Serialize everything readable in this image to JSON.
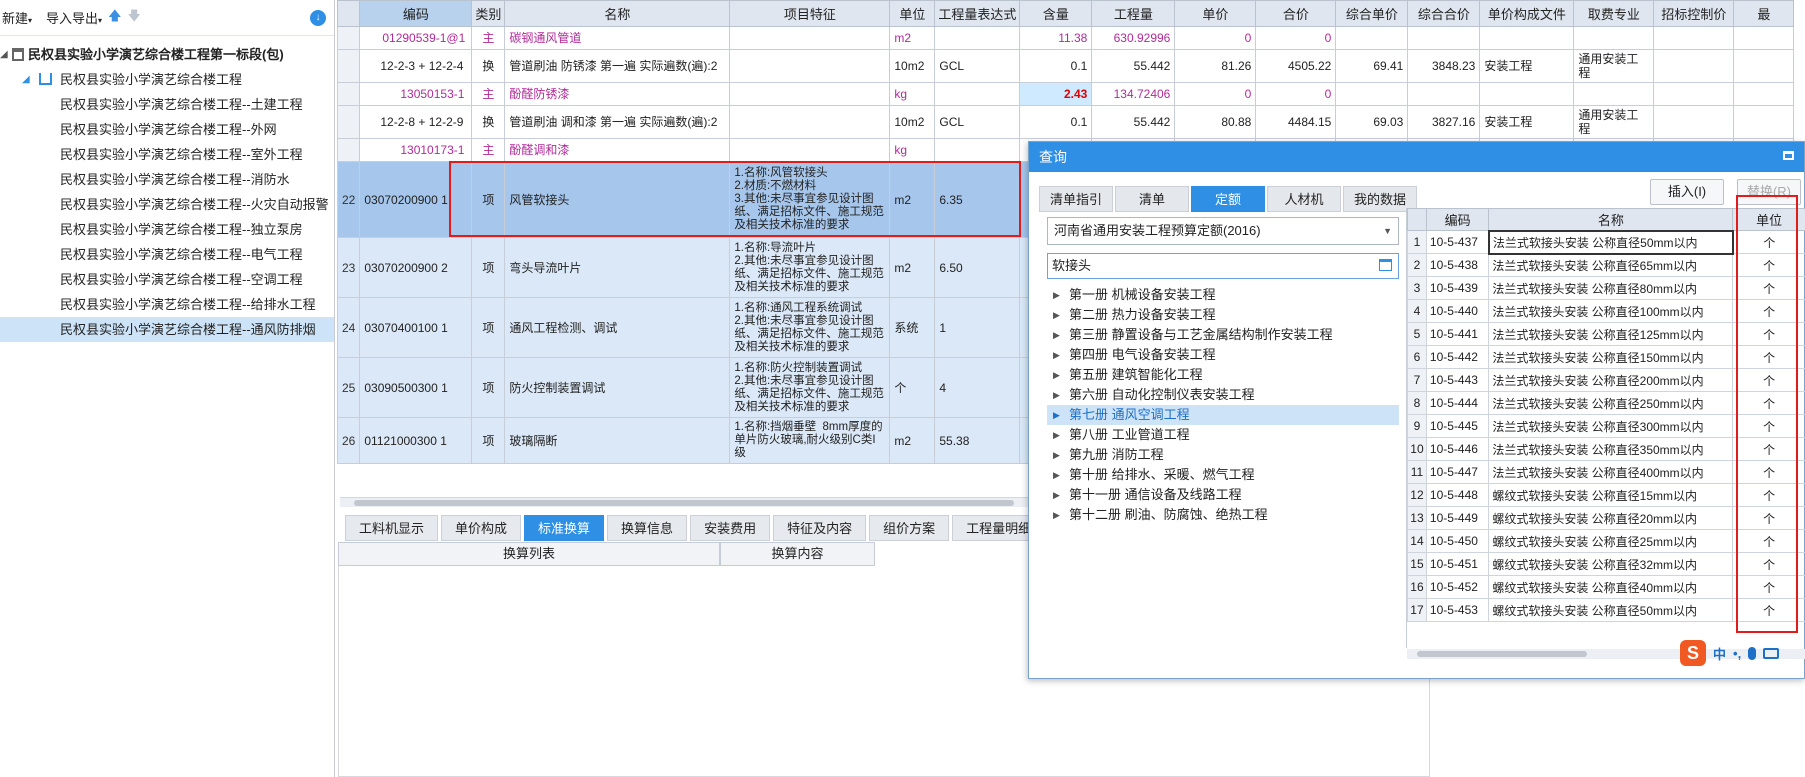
{
  "toolbar": {
    "new_label": "新建",
    "import_export_label": "导入导出"
  },
  "tree": {
    "root": "民权县实验小学演艺综合楼工程第一标段(包)",
    "project": "民权县实验小学演艺综合楼工程",
    "items": [
      "民权县实验小学演艺综合楼工程--土建工程",
      "民权县实验小学演艺综合楼工程--外网",
      "民权县实验小学演艺综合楼工程--室外工程",
      "民权县实验小学演艺综合楼工程--消防水",
      "民权县实验小学演艺综合楼工程--火灾自动报警",
      "民权县实验小学演艺综合楼工程--独立泵房",
      "民权县实验小学演艺综合楼工程--电气工程",
      "民权县实验小学演艺综合楼工程--空调工程",
      "民权县实验小学演艺综合楼工程--给排水工程",
      "民权县实验小学演艺综合楼工程--通风防排烟"
    ]
  },
  "grid": {
    "headers": [
      "编码",
      "类别",
      "名称",
      "项目特征",
      "单位",
      "工程量表达式",
      "含量",
      "工程量",
      "单价",
      "合价",
      "综合单价",
      "综合合价",
      "单价构成文件",
      "取费专业",
      "招标控制价",
      "最"
    ],
    "rows": [
      {
        "ln": "",
        "code": "01290539-1@1",
        "type": "主",
        "name": "碳钢通风管道",
        "feat": "",
        "unit": "m2",
        "expr": "",
        "qty": "11.38",
        "amt": "630.92996",
        "price": "0",
        "total": "0",
        "cup": "",
        "ctot": "",
        "file": "",
        "spec": "",
        "ctrl": ""
      },
      {
        "ln": "",
        "code": "12-2-3 + 12-2-4",
        "type": "换",
        "name": "管道刷油 防锈漆 第一遍  实际遍数(遍):2",
        "feat": "",
        "unit": "10m2",
        "expr": "GCL",
        "qty": "0.1",
        "amt": "55.442",
        "price": "81.26",
        "total": "4505.22",
        "cup": "69.41",
        "ctot": "3848.23",
        "file": "安装工程",
        "spec": "通用安装工程",
        "ctrl": ""
      },
      {
        "ln": "",
        "code": "13050153-1",
        "type": "主",
        "name": "酚醛防锈漆",
        "feat": "",
        "unit": "kg",
        "expr": "",
        "qty": "2.43",
        "amt": "134.72406",
        "price": "0",
        "total": "0",
        "cup": "",
        "ctot": "",
        "file": "",
        "spec": "",
        "ctrl": ""
      },
      {
        "ln": "",
        "code": "12-2-8 + 12-2-9",
        "type": "换",
        "name": "管道刷油 调和漆 第一遍  实际遍数(遍):2",
        "feat": "",
        "unit": "10m2",
        "expr": "GCL",
        "qty": "0.1",
        "amt": "55.442",
        "price": "80.88",
        "total": "4484.15",
        "cup": "69.03",
        "ctot": "3827.16",
        "file": "安装工程",
        "spec": "通用安装工程",
        "ctrl": ""
      },
      {
        "ln": "",
        "code": "13010173-1",
        "type": "主",
        "name": "酚醛调和漆",
        "feat": "",
        "unit": "kg",
        "expr": "",
        "qty": "",
        "amt": "",
        "price": "",
        "total": "",
        "cup": "",
        "ctot": "",
        "file": "",
        "spec": "",
        "ctrl": ""
      },
      {
        "ln": "22",
        "code": "03070200900 1",
        "type": "项",
        "name": "风管软接头",
        "feat": "1.名称:风管软接头\n2.材质:不燃材料\n3.其他:未尽事宜参见设计图纸、满足招标文件、施工规范及相关技术标准的要求",
        "unit": "m2",
        "expr": "6.35",
        "qty": "",
        "amt": "",
        "price": "",
        "total": "",
        "cup": "",
        "ctot": "",
        "file": "",
        "spec": "",
        "ctrl": ""
      },
      {
        "ln": "23",
        "code": "03070200900 2",
        "type": "项",
        "name": "弯头导流叶片",
        "feat": "1.名称:导流叶片\n2.其他:未尽事宜参见设计图纸、满足招标文件、施工规范及相关技术标准的要求",
        "unit": "m2",
        "expr": "6.50",
        "qty": "",
        "amt": "",
        "price": "",
        "total": "",
        "cup": "",
        "ctot": "",
        "file": "",
        "spec": "",
        "ctrl": ""
      },
      {
        "ln": "24",
        "code": "03070400100 1",
        "type": "项",
        "name": "通风工程检测、调试",
        "feat": "1.名称:通风工程系统调试\n2.其他:未尽事宜参见设计图纸、满足招标文件、施工规范及相关技术标准的要求",
        "unit": "系统",
        "expr": "1",
        "qty": "",
        "amt": "",
        "price": "",
        "total": "",
        "cup": "",
        "ctot": "",
        "file": "",
        "spec": "",
        "ctrl": ""
      },
      {
        "ln": "25",
        "code": "03090500300 1",
        "type": "项",
        "name": "防火控制装置调试",
        "feat": "1.名称:防火控制装置调试\n2.其他:未尽事宜参见设计图纸、满足招标文件、施工规范及相关技术标准的要求",
        "unit": "个",
        "expr": "4",
        "qty": "",
        "amt": "",
        "price": "",
        "total": "",
        "cup": "",
        "ctot": "",
        "file": "",
        "spec": "",
        "ctrl": ""
      },
      {
        "ln": "26",
        "code": "01121000300 1",
        "type": "项",
        "name": "玻璃隔断",
        "feat": "1.名称:挡烟垂壁  8mm厚度的单片防火玻璃,耐火级别C类I级",
        "unit": "m2",
        "expr": "55.38",
        "qty": "",
        "amt": "",
        "price": "",
        "total": "",
        "cup": "",
        "ctot": "",
        "file": "",
        "spec": "",
        "ctrl": ""
      }
    ]
  },
  "bottom_tabs": [
    "工料机显示",
    "单价构成",
    "标准换算",
    "换算信息",
    "安装费用",
    "特征及内容",
    "组价方案",
    "工程量明细"
  ],
  "bottom_headers": [
    "换算列表",
    "换算内容"
  ],
  "query": {
    "title": "查询",
    "tabs": [
      "清单指引",
      "清单",
      "定额",
      "人材机",
      "我的数据"
    ],
    "insert_label": "插入(I)",
    "replace_label": "替换(R)",
    "quota_lib": "河南省通用安装工程预算定额(2016)",
    "search_value": "软接头",
    "books": [
      "第一册 机械设备安装工程",
      "第二册 热力设备安装工程",
      "第三册 静置设备与工艺金属结构制作安装工程",
      "第四册 电气设备安装工程",
      "第五册 建筑智能化工程",
      "第六册 自动化控制仪表安装工程",
      "第七册 通风空调工程",
      "第八册 工业管道工程",
      "第九册 消防工程",
      "第十册 给排水、采暖、燃气工程",
      "第十一册 通信设备及线路工程",
      "第十二册 刷油、防腐蚀、绝热工程"
    ],
    "grid_headers": [
      "编码",
      "名称",
      "单位"
    ],
    "results": [
      {
        "code": "10-5-437",
        "name": "法兰式软接头安装 公称直径50mm以内",
        "unit": "个"
      },
      {
        "code": "10-5-438",
        "name": "法兰式软接头安装 公称直径65mm以内",
        "unit": "个"
      },
      {
        "code": "10-5-439",
        "name": "法兰式软接头安装 公称直径80mm以内",
        "unit": "个"
      },
      {
        "code": "10-5-440",
        "name": "法兰式软接头安装 公称直径100mm以内",
        "unit": "个"
      },
      {
        "code": "10-5-441",
        "name": "法兰式软接头安装 公称直径125mm以内",
        "unit": "个"
      },
      {
        "code": "10-5-442",
        "name": "法兰式软接头安装 公称直径150mm以内",
        "unit": "个"
      },
      {
        "code": "10-5-443",
        "name": "法兰式软接头安装 公称直径200mm以内",
        "unit": "个"
      },
      {
        "code": "10-5-444",
        "name": "法兰式软接头安装 公称直径250mm以内",
        "unit": "个"
      },
      {
        "code": "10-5-445",
        "name": "法兰式软接头安装 公称直径300mm以内",
        "unit": "个"
      },
      {
        "code": "10-5-446",
        "name": "法兰式软接头安装 公称直径350mm以内",
        "unit": "个"
      },
      {
        "code": "10-5-447",
        "name": "法兰式软接头安装 公称直径400mm以内",
        "unit": "个"
      },
      {
        "code": "10-5-448",
        "name": "螺纹式软接头安装 公称直径15mm以内",
        "unit": "个"
      },
      {
        "code": "10-5-449",
        "name": "螺纹式软接头安装 公称直径20mm以内",
        "unit": "个"
      },
      {
        "code": "10-5-450",
        "name": "螺纹式软接头安装 公称直径25mm以内",
        "unit": "个"
      },
      {
        "code": "10-5-451",
        "name": "螺纹式软接头安装 公称直径32mm以内",
        "unit": "个"
      },
      {
        "code": "10-5-452",
        "name": "螺纹式软接头安装 公称直径40mm以内",
        "unit": "个"
      },
      {
        "code": "10-5-453",
        "name": "螺纹式软接头安装 公称直径50mm以内",
        "unit": "个"
      }
    ]
  },
  "ime": {
    "logo": "S",
    "lang": "中",
    "punct": "•,"
  },
  "colors": {
    "accent": "#2f8fe4",
    "highlight_box": "#e21b1b",
    "selected_row": "#a6c6ec",
    "main_material": "#b02b9a"
  }
}
